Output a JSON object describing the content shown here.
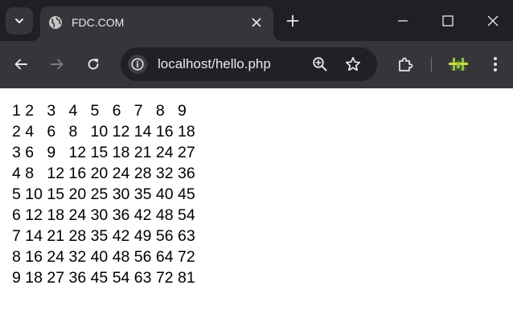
{
  "tab": {
    "title": "FDC.COM"
  },
  "address_bar": {
    "url": "localhost/hello.php"
  },
  "page": {
    "rows": [
      "1 2   3   4   5   6   7   8   9",
      "2 4   6   8   10 12 14 16 18",
      "3 6   9   12 15 18 21 24 27",
      "4 8   12 16 20 24 28 32 36",
      "5 10 15 20 25 30 35 40 45",
      "6 12 18 24 30 36 42 48 54",
      "7 14 21 28 35 42 49 56 63",
      "8 16 24 32 40 48 56 64 72",
      "9 18 27 36 45 54 63 72 81"
    ]
  },
  "icons": {
    "tab_search": "chevron-down-icon",
    "favicon": "globe-icon",
    "tab_close": "close-icon",
    "new_tab": "plus-icon",
    "minimize": "minimize-icon",
    "maximize": "maximize-icon",
    "window_close": "close-icon",
    "back": "arrow-left-icon",
    "forward": "arrow-right-icon",
    "reload": "reload-icon",
    "site_info": "info-icon",
    "zoom": "zoom-in-icon",
    "bookmark": "star-icon",
    "extensions": "puzzle-icon",
    "profile": "extension-badge-icon",
    "menu": "more-vert-icon"
  },
  "colors": {
    "tabstrip_bg": "#1f2023",
    "toolbar_bg": "#35363a",
    "omnibox_bg": "#202124",
    "text_light": "#e8eaed",
    "page_bg": "#ffffff",
    "page_text": "#000000",
    "profile_accent": "#8bc34a"
  }
}
